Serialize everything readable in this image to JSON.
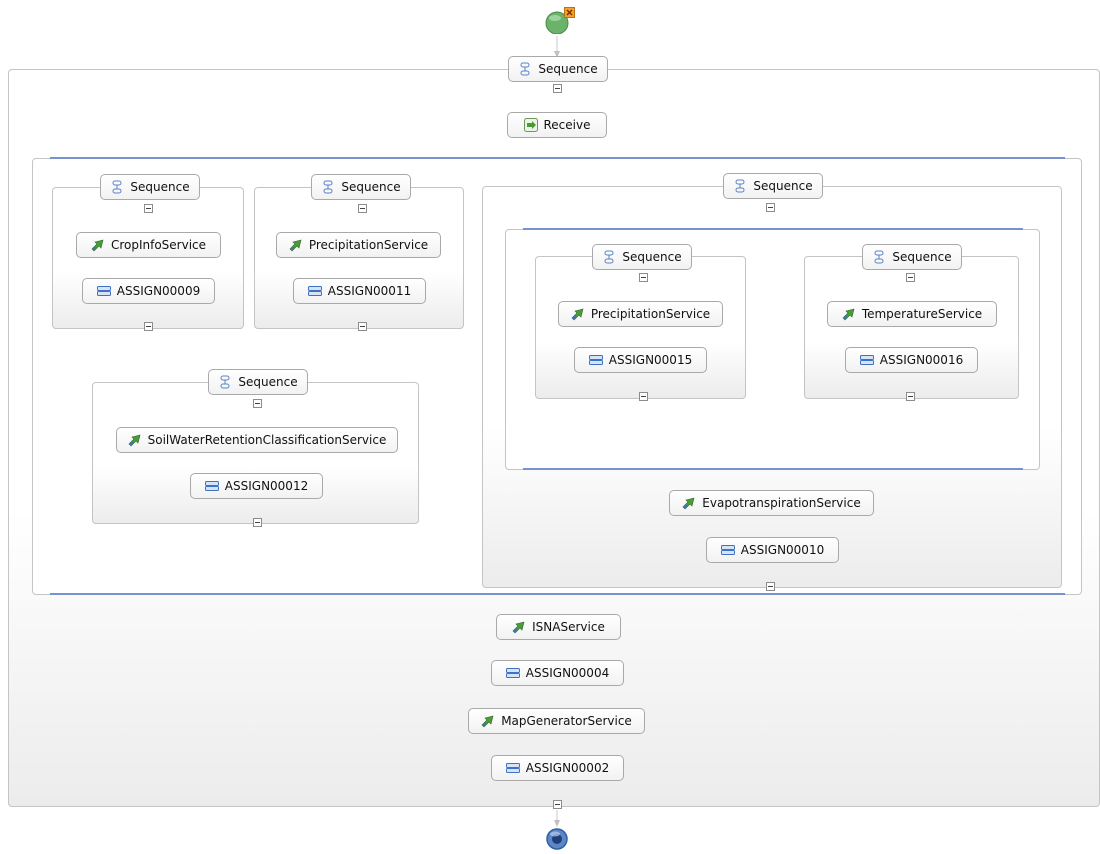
{
  "nodes": {
    "sequence_main": "Sequence",
    "receive": "Receive",
    "sequence_crop": "Sequence",
    "crop_info_service": "CropInfoService",
    "assign_00009": "ASSIGN00009",
    "sequence_precip": "Sequence",
    "precipitation_service_a": "PrecipitationService",
    "assign_00011": "ASSIGN00011",
    "sequence_soil": "Sequence",
    "soil_water_service": "SoilWaterRetentionClassificationService",
    "assign_00012": "ASSIGN00012",
    "sequence_evapo": "Sequence",
    "sequence_precip_inner": "Sequence",
    "precipitation_service_b": "PrecipitationService",
    "assign_00015": "ASSIGN00015",
    "sequence_temp": "Sequence",
    "temperature_service": "TemperatureService",
    "assign_00016": "ASSIGN00016",
    "evapotranspiration_service": "EvapotranspirationService",
    "assign_00010": "ASSIGN00010",
    "isna_service": "ISNAService",
    "assign_00004": "ASSIGN00004",
    "map_generator_service": "MapGeneratorService",
    "assign_00002": "ASSIGN00002"
  },
  "icons": {
    "sequence": "sequence-icon",
    "receive": "receive-icon",
    "invoke": "invoke-icon",
    "assign": "assign-icon",
    "start": "start-event-icon",
    "end": "end-event-icon",
    "close": "close-icon",
    "collapse": "collapse-icon"
  },
  "colors": {
    "flow_bar": "#7593cf",
    "start_event": "#6bb36b",
    "end_event": "#2f5fa7",
    "close_marker": "#f0a030",
    "invoke_arrow": "#4a9c3a",
    "assign_icon": "#3f72c4"
  }
}
